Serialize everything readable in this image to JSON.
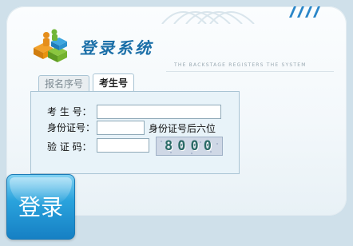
{
  "header": {
    "title": "登录系统",
    "subtitle": "THE BACKSTAGE REGISTERS THE SYSTEM"
  },
  "tabs": [
    {
      "label": "报名序号",
      "active": false
    },
    {
      "label": "考生号",
      "active": true
    }
  ],
  "form": {
    "exam_no_label": "考 生 号：",
    "exam_no_value": "",
    "id_label": "身份证号：",
    "id_value": "",
    "id_hint": "身份证号后六位",
    "captcha_label": "验 证 码：",
    "captcha_value": "",
    "captcha_image_text": "8000"
  },
  "login_button": {
    "label": "登录"
  },
  "colors": {
    "accent": "#1b6fa8",
    "button": "#2aa3dd",
    "form_bg": "#e8f3f9"
  }
}
